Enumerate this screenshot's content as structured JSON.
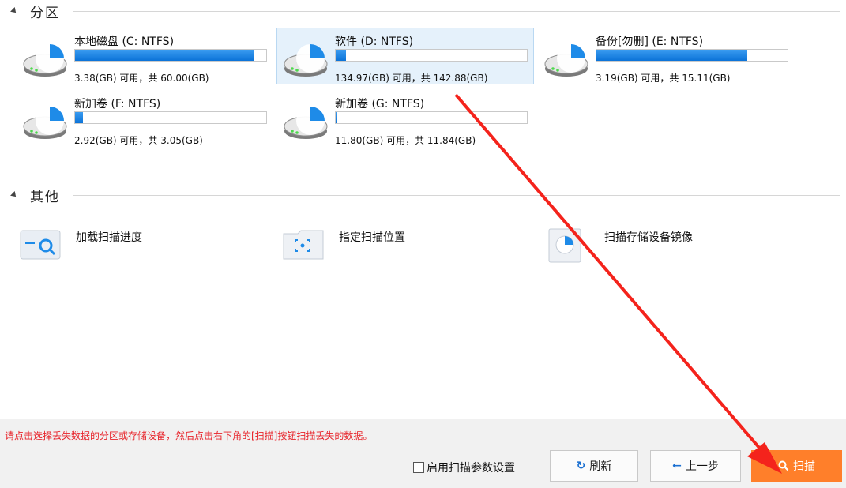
{
  "sections": {
    "partitions_title": "分区",
    "other_title": "其他"
  },
  "partitions": [
    {
      "name": "本地磁盘 (C: NTFS)",
      "info": "3.38(GB) 可用，共 60.00(GB)",
      "used_fraction": 0.94,
      "selected": false
    },
    {
      "name": "软件 (D: NTFS)",
      "info": "134.97(GB) 可用，共 142.88(GB)",
      "used_fraction": 0.055,
      "selected": true
    },
    {
      "name": "备份[勿删] (E: NTFS)",
      "info": "3.19(GB) 可用，共 15.11(GB)",
      "used_fraction": 0.79,
      "selected": false
    },
    {
      "name": "新加卷 (F: NTFS)",
      "info": "2.92(GB) 可用，共 3.05(GB)",
      "used_fraction": 0.043,
      "selected": false
    },
    {
      "name": "新加卷 (G: NTFS)",
      "info": "11.80(GB) 可用，共 11.84(GB)",
      "used_fraction": 0.003,
      "selected": false
    }
  ],
  "others": [
    {
      "label": "加载扫描进度",
      "icon": "load-progress-icon"
    },
    {
      "label": "指定扫描位置",
      "icon": "folder-target-icon"
    },
    {
      "label": "扫描存储设备镜像",
      "icon": "disk-image-icon"
    }
  ],
  "footer": {
    "hint": "请点击选择丢失数据的分区或存储设备，然后点击右下角的[扫描]按钮扫描丢失的数据。",
    "checkbox_label": "启用扫描参数设置",
    "refresh_label": "刷新",
    "back_label": "上一步",
    "scan_label": "扫描"
  },
  "colors": {
    "accent": "#ff7f2a",
    "bar_fill": "#1a7fe0",
    "hint_text": "#e8242b",
    "selected_bg": "#e5f1fb",
    "annotation_arrow": "#f4231c"
  }
}
